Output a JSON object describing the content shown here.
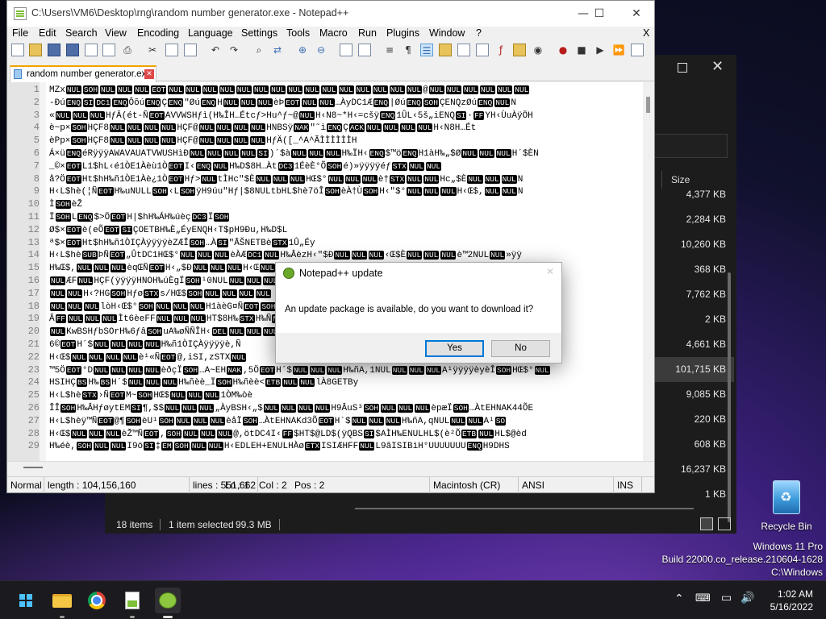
{
  "notepad": {
    "title": "C:\\Users\\VM6\\Desktop\\rng\\random number generator.exe - Notepad++",
    "window_controls": {
      "minimize": "—",
      "maximize": "☐",
      "close": "✕"
    },
    "menu": [
      "File",
      "Edit",
      "Search",
      "View",
      "Encoding",
      "Language",
      "Settings",
      "Tools",
      "Macro",
      "Run",
      "Plugins",
      "Window",
      "?"
    ],
    "menu_close": "X",
    "tab": {
      "label": "random number generator.exe",
      "close": "✕"
    },
    "line_numbers": [
      "1",
      "2",
      "3",
      "4",
      "5",
      "6",
      "7",
      "8",
      "9",
      "10",
      "11",
      "12",
      "13",
      "14",
      "15",
      "16",
      "17",
      "18",
      "19",
      "20",
      "21",
      "22",
      "23",
      "24",
      "25",
      "26",
      "27",
      "28",
      "29"
    ],
    "lines": [
      "MZx NUL SOH NUL NUL NUL EOT NUL NUL NUL NUL NUL NUL NUL NUL NUL NUL NUL NUL NUL NUL NUL @ NUL NUL NUL NUL NUL NUL",
      "-ÐúENQ SI DC1 ENQ ÔõúENQ ÇENQ\"ØúENQ H NUL NUL NUL èÞEOT NUL NUL …ÀyDC1 ÆENQ|ØúENQ SOH ÇENQzØúENQ NUL N",
      "«NUL NUL NUL HƒÄ(ét-ÑEOT AVVWSHƒì(H‰ÎH…Étcƒ>Hu^ƒ~@NUL H‹N8~*H‹=cšÿENQ 1ÛL‹5š„iENQ SI ·FF YH‹ÙuÀÿÖH",
      "è~p×SOH HÇF8 NUL NUL NUL NUL HÇF@NUL NUL NUL NUL HNBS ÿNAK\"˜ìENQ ÇACK NUL NUL NUL NUL H‹N8H…Ét",
      "èPp×SOH HÇF8 NUL NUL NUL NUL HÇF@NUL NUL NUL NUL HƒÄ([_^A^ÃÌÌÌÌÌÌH",
      "Á×üENQ éRÿÿÿAWAVAUATVWUSHìÐNUL NUL NUL NUL SI)´$àNUL NUL NUL H‰ÏH‹ENQ $™öENQ H1àH‰„$ØNUL NUL NUL H´$ÈN",
      "_©×EOT L1$hL‹é1ÒE1Àèù1ÒEOT I‹ENQ NUL H‰D$8H…Àt DC3 1ÉèÈ°ÕSOH é)»ÿÿÿÿéƒSTX NUL NUL",
      "å?ÖEOT Ht$hH‰ñ1ÒE1Àè¿1ÒEOT Hƒ>NUL tÌHc\"$ÈNUL NUL NUL HŒ$°NUL NUL NUL è†STX NUL NUL Hc„$ÈNUL NUL NUL N",
      "H‹L$hè(¦ÑEOT H‰uNUL L SOH ‹L SOH ÿH9úu\"Hƒ|$8NUL tbHL$hè7öÎSOH èÀ†ÙSOH H‹\"$°NUL NUL NUL H‹Œ$,NUL NUL N",
      "ÌSOH è Ž",
      "ÏSOH L ENQ $>ÖEOT H|$hH‰ÁH‰úèç DC3 Ï SOH",
      "Ø$×EOT è(eÕEOT SI ÇOETB H‰È„ÉyENQ H‹T$pH9Ðu,H‰D$ L",
      "ª$×EOT Ht$hH‰ñ1ÒIÇÀÿÿÿÿèZÆÎSOH …ÀSI\"ÃŠNETB èSTX 1Û„Éy",
      "H‹L$hèSUB ÞÑEOT „ÛtDC1 HŒ$°NUL NUL NUL èÀÆDC1 NUL H‰ÂèzH‹\"$ÐNUL NUL NUL ‹Œ$ÈNUL NUL NUL è™2NUL NUL »ÿÿ",
      "H‰Œ$,NUL NUL NUL èqŒÑEOT H‹„$ÐNUL NUL NUL H‹ŒNUL …‡$¥NUL NUL NUL H‹L NUL NUL NUL NUL SOH )´$àNUL",
      "NUL ÆF NUL HÇF(ÿÿÿÿHNOH‰úÈgÏSOH ¹0NUL NUL NUL NUL NUL NUL NUL NUL NUL NUL NUL NUL NUL NUL NUL NUL NUL H‰Àè÷NUL",
      "NUL NUL H‹?HG SOH HƒøSTX s/HŒ$ SOH NUL NUL NUL NUL",
      "NUL NUL NUL lòH‹Œ$°SOH NUL NUL NUL H1àèG¤ÑEOT SOH NUL NUL NUL NUL NUL NUL NUL …)1ÒSTX H‰FBS H",
      "ÂFF NUL NUL NUL Ìt6èeFF NUL NUL NUL HT$8H‰STX H‰Ñ NUL NUL NUL NUL NUL NUL NUL NUL NUL NUL NUL LÉÝNUL",
      "NUL KwBS HƒbSOr H‰6ƒâSOH uA‰øÑÑÎH‹DEL NUL NUL NUL NUL NUL NUL NUL NUL NUL NUL NUL NUL NUL NUL øSYN",
      "6©EOT H´$ NUL NUL NUL NUL H‰ñ1ÒIÇÀÿÿÿÿè,Ñ",
      "H‹Œ$ NUL NUL NUL NUL è¹«ÑEOT @,iSI ,zSTX NUL",
      "™5ÖEOT °D NUL NUL NUL NUL èðçÏSOH …A~EH NAK ,5ÖEOT H´$ NUL NUL NUL H‰ñA,1NUL NUL NUL NUL A¹ÿÿÿÿèyèÎSOH HŒ$°NUL",
      "HSIHÇBS H‰BS H´$ NUL NUL NUL H‰ñèè_ÏSOH H‰ñèè<ETB NUL NUL lÀ8GETB y",
      "H‹L$hèSTX ›ÑEOT M~SOH HŒ$NUL NUL NUL 1ÒM‰òè",
      "ÎÎSOH H‰ÂHƒøytEM SI ¶,$$NUL NUL NUL „ÀyBS H‹„$NUL NUL NUL NUL H9ÂuS³SOH NUL NUL NUL èpæÏSOH …ÀtEHNAK 44ÕE",
      "H‹L$hèÿ™ÑEOT @¶SOH èU¹SOH NUL NUL NUL è åÏSOH …ÀtEHNAK d3ÕEOT H´$ NUL NUL NUL H‰ñA,qNUL NUL NUL A¹SO",
      "H‹Œ$NUL NUL NUL è Ž™ÑEOT ,SOH NUL NUL NUL @,ötDC4 I‹FF $HT$@LD$(ÿQBS SI $AÌH‰ENUL HL$(è²ÕETB NUL HL$@èd",
      "H‰éè,SOH NUL NUL I9öSI ‡EM SOH NUL NUL H‹ EDLE H+ENUL HÀøETX ISI ÆHFF NUL L9âISI BìH°UUUUUUU ENQ H9DH S"
    ],
    "status": {
      "lang": "Normal",
      "length": "length : 104,156,160",
      "lines": "lines : 551,662",
      "ln": "Ln : 1",
      "col": "Col : 2",
      "pos": "Pos : 2",
      "eol": "Macintosh (CR)",
      "enc": "ANSI",
      "mode": "INS"
    }
  },
  "dialog": {
    "title": "Notepad++ update",
    "close": "✕",
    "message": "An update package is available, do you want to download it?",
    "yes": "Yes",
    "no": "No"
  },
  "explorer": {
    "column": "Size",
    "sizes": [
      "4,377 KB",
      "2,284 KB",
      "10,260 KB",
      "368 KB",
      "7,762 KB",
      "2 KB",
      "4,661 KB",
      "101,715 KB",
      "9,085 KB",
      "220 KB",
      "608 KB",
      "16,237 KB",
      "1 KB"
    ],
    "selected_index": 7,
    "status_items": "18 items",
    "status_selected": "1 item selected",
    "status_size": "99.3 MB"
  },
  "desktop": {
    "recycle_bin": "Recycle Bin",
    "watermark": [
      "Windows 11 Pro",
      "Build 22000.co_release.210604-1628",
      "C:\\Windows"
    ]
  },
  "taskbar": {
    "time": "1:02 AM",
    "date": "5/16/2022",
    "icons": [
      "start-icon",
      "file-explorer-icon",
      "chrome-icon",
      "notepad-icon",
      "notepad-plus-plus-icon"
    ]
  }
}
